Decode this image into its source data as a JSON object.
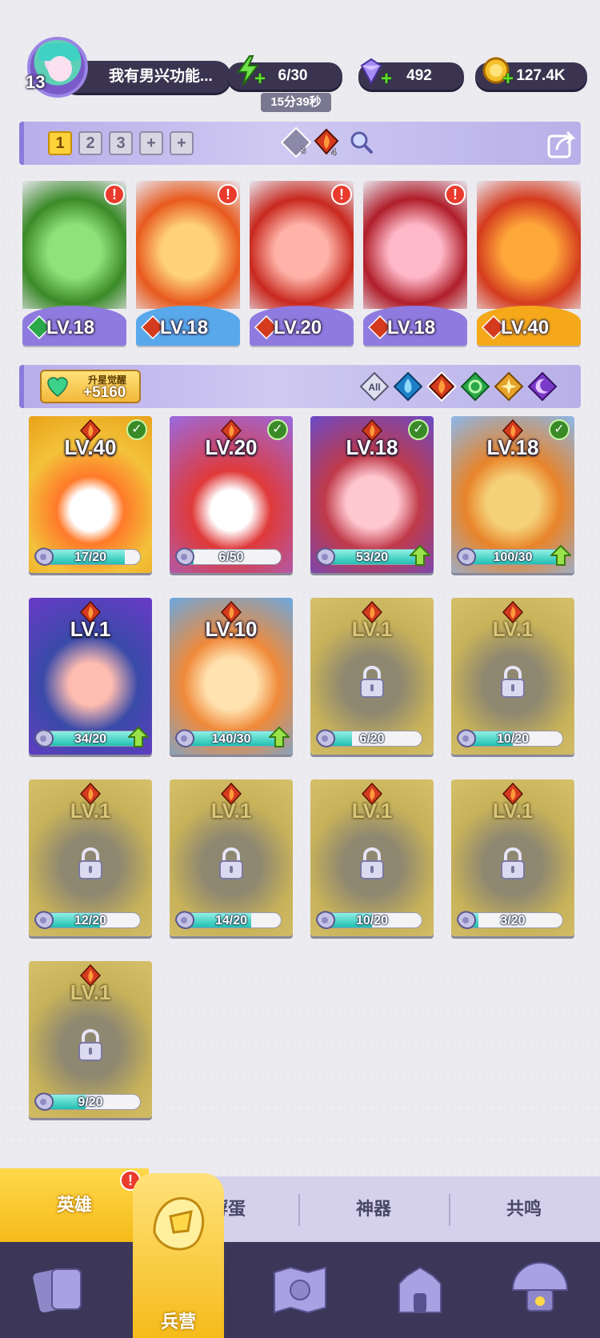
{
  "profile": {
    "level": "13",
    "name": "我有男兴功能..."
  },
  "resources": {
    "energy": "6/30",
    "energy_timer": "15分39秒",
    "gems": "492",
    "coins": "127.4K"
  },
  "team": {
    "tabs": [
      "1",
      "2",
      "3",
      "+",
      "+"
    ],
    "active_tab": "1",
    "counters": [
      {
        "icon": "shard-icon",
        "count": "3"
      },
      {
        "icon": "fire-element-icon",
        "count": "4"
      }
    ],
    "heroes": [
      {
        "level": "LV.18",
        "element": "wind",
        "alert": "!"
      },
      {
        "level": "LV.18",
        "element": "fire",
        "alert": "!"
      },
      {
        "level": "LV.20",
        "element": "fire",
        "alert": "!"
      },
      {
        "level": "LV.18",
        "element": "fire",
        "alert": "!"
      },
      {
        "level": "LV.40",
        "element": "fire",
        "alert": ""
      }
    ]
  },
  "awaken": {
    "label": "升星觉醒",
    "value": "+5160"
  },
  "filters": [
    "All",
    "water",
    "fire",
    "wind",
    "light",
    "dark"
  ],
  "heroes": [
    {
      "level": "LV.40",
      "shards": "17/20",
      "progress": 0.85,
      "awakened": true,
      "locked": false,
      "upgradable": false
    },
    {
      "level": "LV.20",
      "shards": "6/50",
      "progress": 0.12,
      "awakened": true,
      "locked": false,
      "upgradable": false
    },
    {
      "level": "LV.18",
      "shards": "53/20",
      "progress": 1.0,
      "awakened": true,
      "locked": false,
      "upgradable": true
    },
    {
      "level": "LV.18",
      "shards": "100/30",
      "progress": 1.0,
      "awakened": true,
      "locked": false,
      "upgradable": true
    },
    {
      "level": "LV.1",
      "shards": "34/20",
      "progress": 1.0,
      "awakened": false,
      "locked": false,
      "upgradable": true
    },
    {
      "level": "LV.10",
      "shards": "140/30",
      "progress": 1.0,
      "awakened": false,
      "locked": false,
      "upgradable": true
    },
    {
      "level": "LV.1",
      "shards": "6/20",
      "progress": 0.3,
      "awakened": false,
      "locked": true,
      "upgradable": false
    },
    {
      "level": "LV.1",
      "shards": "10/20",
      "progress": 0.5,
      "awakened": false,
      "locked": true,
      "upgradable": false
    },
    {
      "level": "LV.1",
      "shards": "12/20",
      "progress": 0.6,
      "awakened": false,
      "locked": true,
      "upgradable": false
    },
    {
      "level": "LV.1",
      "shards": "14/20",
      "progress": 0.7,
      "awakened": false,
      "locked": true,
      "upgradable": false
    },
    {
      "level": "LV.1",
      "shards": "10/20",
      "progress": 0.5,
      "awakened": false,
      "locked": true,
      "upgradable": false
    },
    {
      "level": "LV.1",
      "shards": "3/20",
      "progress": 0.15,
      "awakened": false,
      "locked": true,
      "upgradable": false
    },
    {
      "level": "LV.1",
      "shards": "9/20",
      "progress": 0.45,
      "awakened": false,
      "locked": true,
      "upgradable": false
    }
  ],
  "sub_tabs": [
    {
      "label": "英雄",
      "active": true,
      "alert": "!"
    },
    {
      "label": "孵蛋",
      "active": false
    },
    {
      "label": "神器",
      "active": false
    },
    {
      "label": "共鸣",
      "active": false
    }
  ],
  "nav": [
    {
      "icon": "cards-icon",
      "label": ""
    },
    {
      "icon": "barracks-icon",
      "label": "兵营",
      "active": true
    },
    {
      "icon": "map-icon",
      "label": ""
    },
    {
      "icon": "castle-icon",
      "label": ""
    },
    {
      "icon": "mushroom-house-icon",
      "label": ""
    }
  ],
  "colors": {
    "accent": "#ffd23a",
    "panel": "#3a3450",
    "progress": "#21bfb1"
  }
}
